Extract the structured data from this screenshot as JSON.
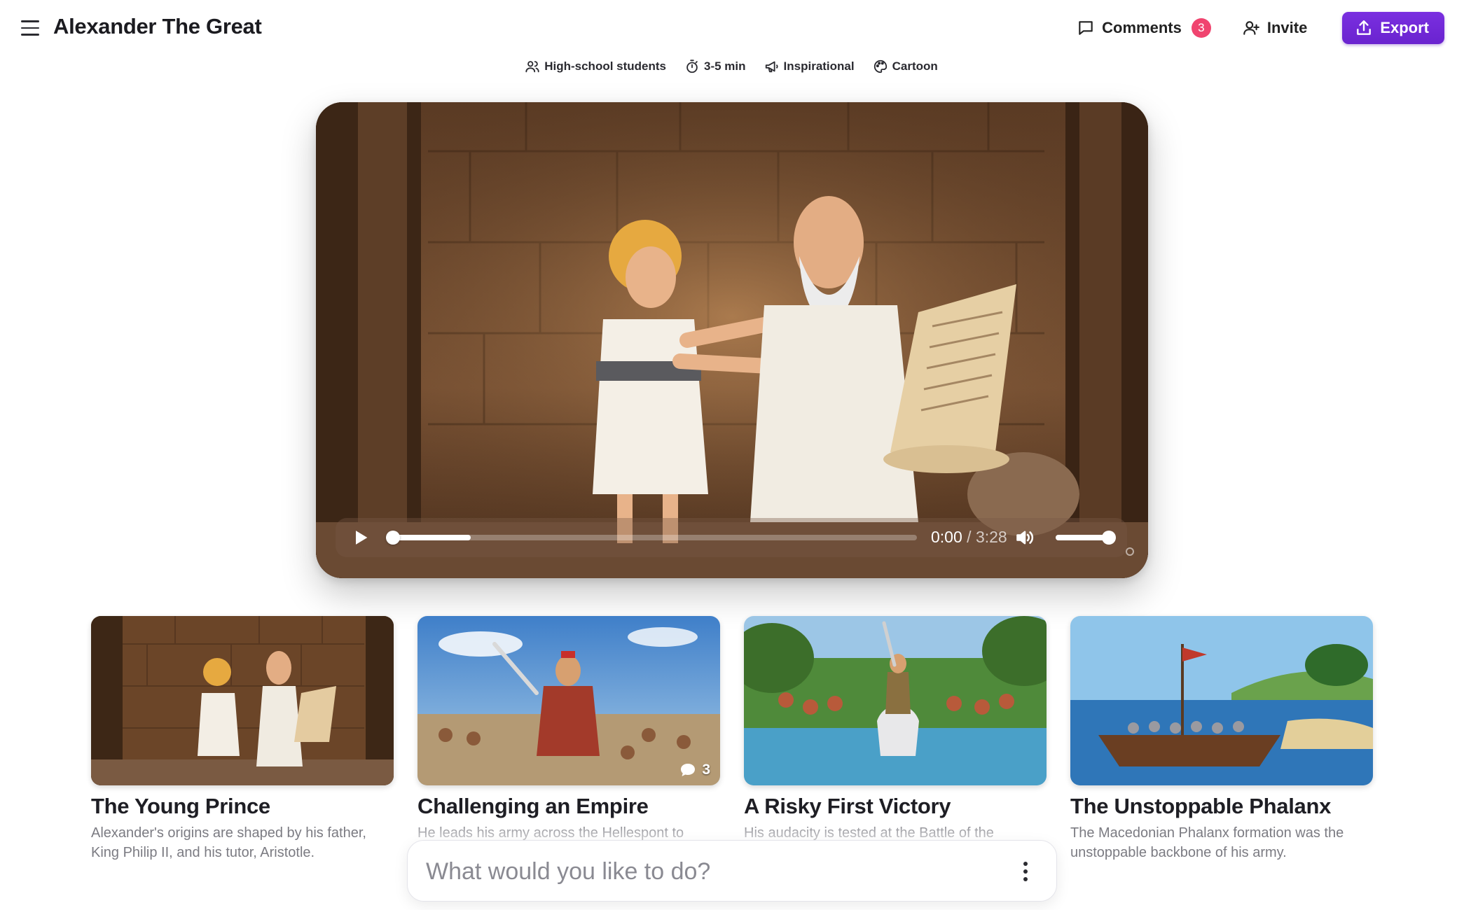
{
  "header": {
    "title": "Alexander The Great",
    "comments_label": "Comments",
    "comments_count": "3",
    "invite_label": "Invite",
    "export_label": "Export"
  },
  "tags": [
    {
      "label": "High-school students",
      "icon": "users-icon"
    },
    {
      "label": "3-5 min",
      "icon": "stopwatch-icon"
    },
    {
      "label": "Inspirational",
      "icon": "megaphone-icon"
    },
    {
      "label": "Cartoon",
      "icon": "palette-icon"
    }
  ],
  "player": {
    "current_time": "0:00",
    "separator": "/",
    "duration": "3:28",
    "progress_fraction": 0.15,
    "volume_fraction": 1.0
  },
  "cards": [
    {
      "title": "The Young Prince",
      "description": "Alexander's origins are shaped by his father, King Philip II, and his tutor, Aristotle.",
      "comments": ""
    },
    {
      "title": "Challenging an Empire",
      "description": "He leads his army across the Hellespont to",
      "comments": "3"
    },
    {
      "title": "A Risky First Victory",
      "description": "His audacity is tested at the Battle of the",
      "comments": ""
    },
    {
      "title": "The Unstoppable Phalanx",
      "description": "The Macedonian Phalanx formation was the unstoppable backbone of his army.",
      "comments": ""
    }
  ],
  "prompt": {
    "placeholder": "What would you like to do?"
  },
  "colors": {
    "accent": "#6f27d6",
    "badge": "#f0446f"
  }
}
